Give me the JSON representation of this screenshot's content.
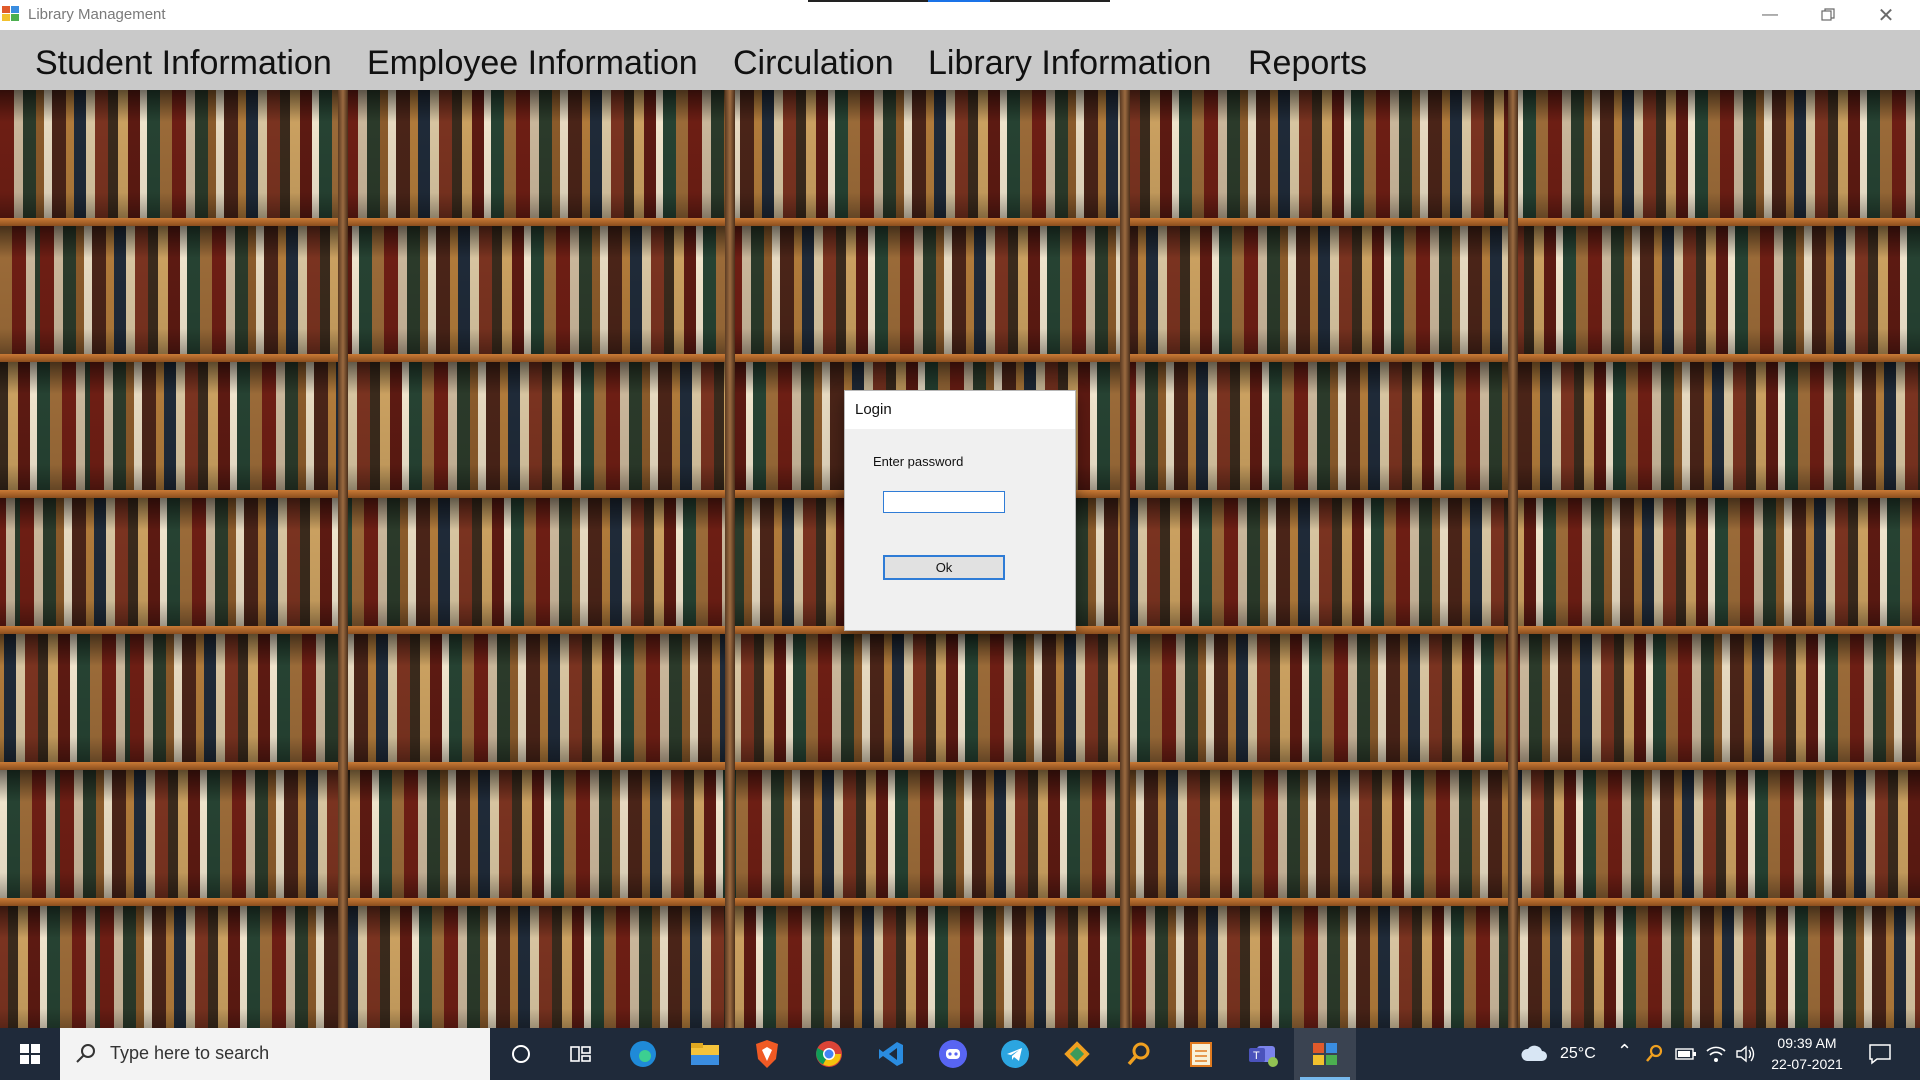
{
  "window": {
    "title": "Library Management",
    "controls": {
      "minimize_icon": "minimize-icon",
      "maximize_icon": "restore-icon",
      "close_icon": "close-icon"
    }
  },
  "menu": {
    "items": [
      "Student Information",
      "Employee Information",
      "Circulation",
      "Library Information",
      "Reports"
    ]
  },
  "background": {
    "description_icon": "bookshelf-image"
  },
  "dialog": {
    "title": "Login",
    "label": "Enter password",
    "password_value": "",
    "ok_label": "Ok",
    "accent_color": "#2f7cd6"
  },
  "taskbar": {
    "search_placeholder": "Type here to search",
    "apps": [
      "cortana-icon",
      "task-view-icon",
      "edge-icon",
      "file-explorer-icon",
      "brave-icon",
      "chrome-icon",
      "vscode-icon",
      "discord-icon",
      "telegram-icon",
      "git-icon",
      "search-app-icon",
      "notepad-icon",
      "teams-icon",
      "library-app-icon"
    ],
    "weather": "25°C",
    "time": "09:39 AM",
    "date": "22-07-2021"
  }
}
